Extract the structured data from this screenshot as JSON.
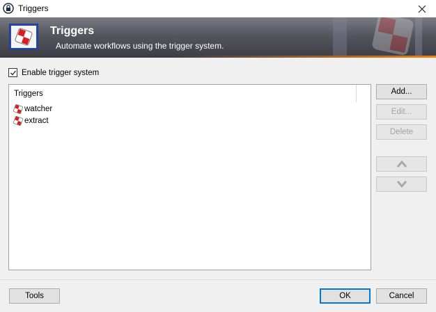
{
  "window": {
    "title": "Triggers",
    "close_icon": "close-icon",
    "app_icon": "lock-icon"
  },
  "banner": {
    "heading": "Triggers",
    "subheading": "Automate workflows using the trigger system.",
    "icon": "trigger-logo-icon",
    "accent_color": "#f08010"
  },
  "enable": {
    "label": "Enable trigger system",
    "checked": true
  },
  "list": {
    "column_header": "Triggers",
    "items": [
      {
        "label": "watcher",
        "icon": "trigger-icon"
      },
      {
        "label": "extract",
        "icon": "trigger-icon"
      }
    ]
  },
  "side_buttons": {
    "add": "Add...",
    "edit": "Edit...",
    "delete": "Delete",
    "move_up_icon": "chevron-up-icon",
    "move_down_icon": "chevron-down-icon"
  },
  "footer": {
    "tools": "Tools",
    "ok": "OK",
    "cancel": "Cancel"
  }
}
